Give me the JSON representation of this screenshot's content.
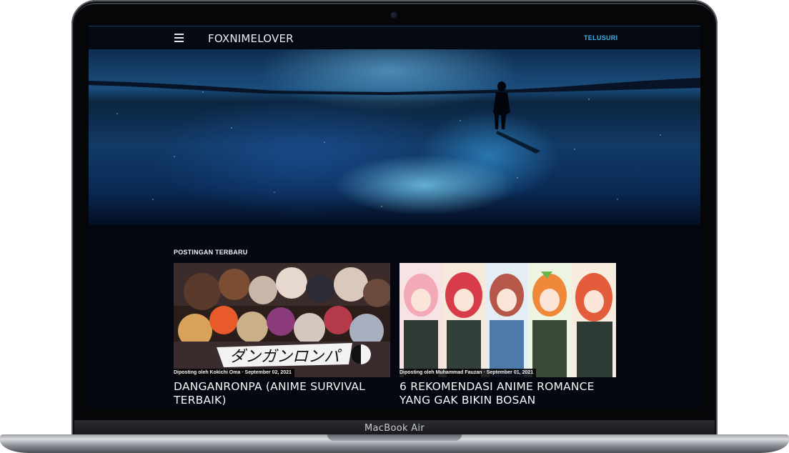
{
  "device": {
    "model_label": "MacBook Air"
  },
  "header": {
    "menu_icon": "hamburger-menu-icon",
    "site_title": "FOXNIMELOVER",
    "search_label": "TELUSURI",
    "accent_color": "#3fb5ea"
  },
  "main": {
    "section_title": "POSTINGAN TERBARU",
    "posts": [
      {
        "byline": "Diposting oleh Kokichi Oma · September 02, 2021",
        "title": "DANGANRONPA (ANIME SURVIVAL TERBAIK)"
      },
      {
        "byline": "Diposting oleh Muhammad Fauzan · September 01, 2021",
        "title": "6 REKOMENDASI ANIME ROMANCE YANG GAK BIKIN BOSAN"
      }
    ]
  }
}
